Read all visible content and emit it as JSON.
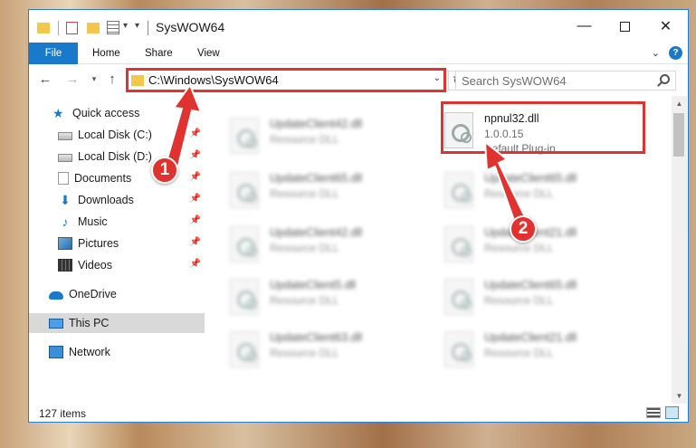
{
  "window": {
    "title": "SysWOW64",
    "ribbon_tabs": [
      "File",
      "Home",
      "Share",
      "View"
    ],
    "help_label": "?"
  },
  "nav": {
    "address": "C:\\Windows\\SysWOW64",
    "search_placeholder": "Search SysWOW64"
  },
  "sidebar": {
    "items": [
      {
        "label": "Quick access",
        "icon": "star-icon"
      },
      {
        "label": "Local Disk (C:)",
        "icon": "disk-icon"
      },
      {
        "label": "Local Disk (D:)",
        "icon": "disk-icon"
      },
      {
        "label": "Documents",
        "icon": "documents-icon"
      },
      {
        "label": "Downloads",
        "icon": "download-icon"
      },
      {
        "label": "Music",
        "icon": "music-icon"
      },
      {
        "label": "Pictures",
        "icon": "pictures-icon"
      },
      {
        "label": "Videos",
        "icon": "videos-icon"
      },
      {
        "label": "OneDrive",
        "icon": "cloud-icon"
      },
      {
        "label": "This PC",
        "icon": "computer-icon"
      },
      {
        "label": "Network",
        "icon": "network-icon"
      }
    ],
    "selected": "This PC"
  },
  "files": [
    {
      "name": "UpdateClient42.dll",
      "type": "Resource DLL"
    },
    {
      "name": "npnul32.dll",
      "version": "1.0.0.15",
      "type": "Default Plug-in"
    },
    {
      "name": "UpdateClient65.dll",
      "type": "Resource DLL"
    },
    {
      "name": "UpdateClient65.dll",
      "type": "Resource DLL"
    },
    {
      "name": "UpdateClient42.dll",
      "type": "Resource DLL"
    },
    {
      "name": "UpdateClient21.dll",
      "type": "Resource DLL"
    },
    {
      "name": "UpdateClient5.dll",
      "type": "Resource DLL"
    },
    {
      "name": "UpdateClient65.dll",
      "type": "Resource DLL"
    },
    {
      "name": "UpdateClient63.dll",
      "type": "Resource DLL"
    },
    {
      "name": "UpdateClient21.dll",
      "type": "Resource DLL"
    }
  ],
  "status": {
    "item_count": "127 items"
  },
  "markers": {
    "one": "1",
    "two": "2"
  },
  "colors": {
    "accent": "#1979ca",
    "highlight": "#e0322f"
  }
}
